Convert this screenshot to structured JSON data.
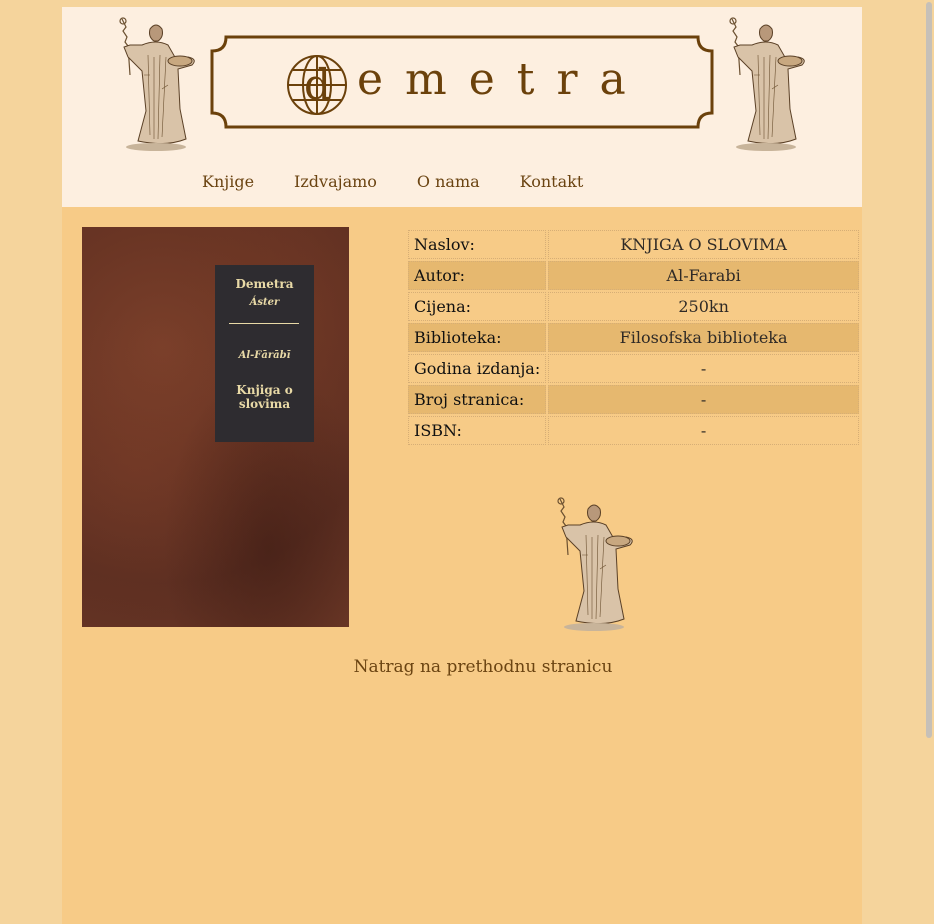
{
  "header": {
    "logo_text": "emetra",
    "logo_initial": "d",
    "nav": [
      "Knjige",
      "Izdvajamo",
      "O nama",
      "Kontakt"
    ]
  },
  "cover": {
    "publisher": "Demetra",
    "series": "Áster",
    "author": "Al-Fārābī",
    "title": "Knjiga o slovima"
  },
  "details": [
    {
      "label": "Naslov:",
      "value": "KNJIGA O SLOVIMA"
    },
    {
      "label": "Autor:",
      "value": "Al-Farabi"
    },
    {
      "label": "Cijena:",
      "value": "250kn"
    },
    {
      "label": "Biblioteka:",
      "value": "Filosofska biblioteka"
    },
    {
      "label": "Godina izdanja:",
      "value": "-"
    },
    {
      "label": "Broj stranica:",
      "value": "-"
    },
    {
      "label": "ISBN:",
      "value": "-"
    }
  ],
  "back_link": "Natrag na prethodnu stranicu",
  "colors": {
    "background": "#f5d49c",
    "content": "#f7cb87",
    "header": "#fdefe0",
    "accent": "#6b410b",
    "row_alt": "#e6b86f"
  },
  "icons": [
    "demeter-statue-icon",
    "globe-icon"
  ]
}
